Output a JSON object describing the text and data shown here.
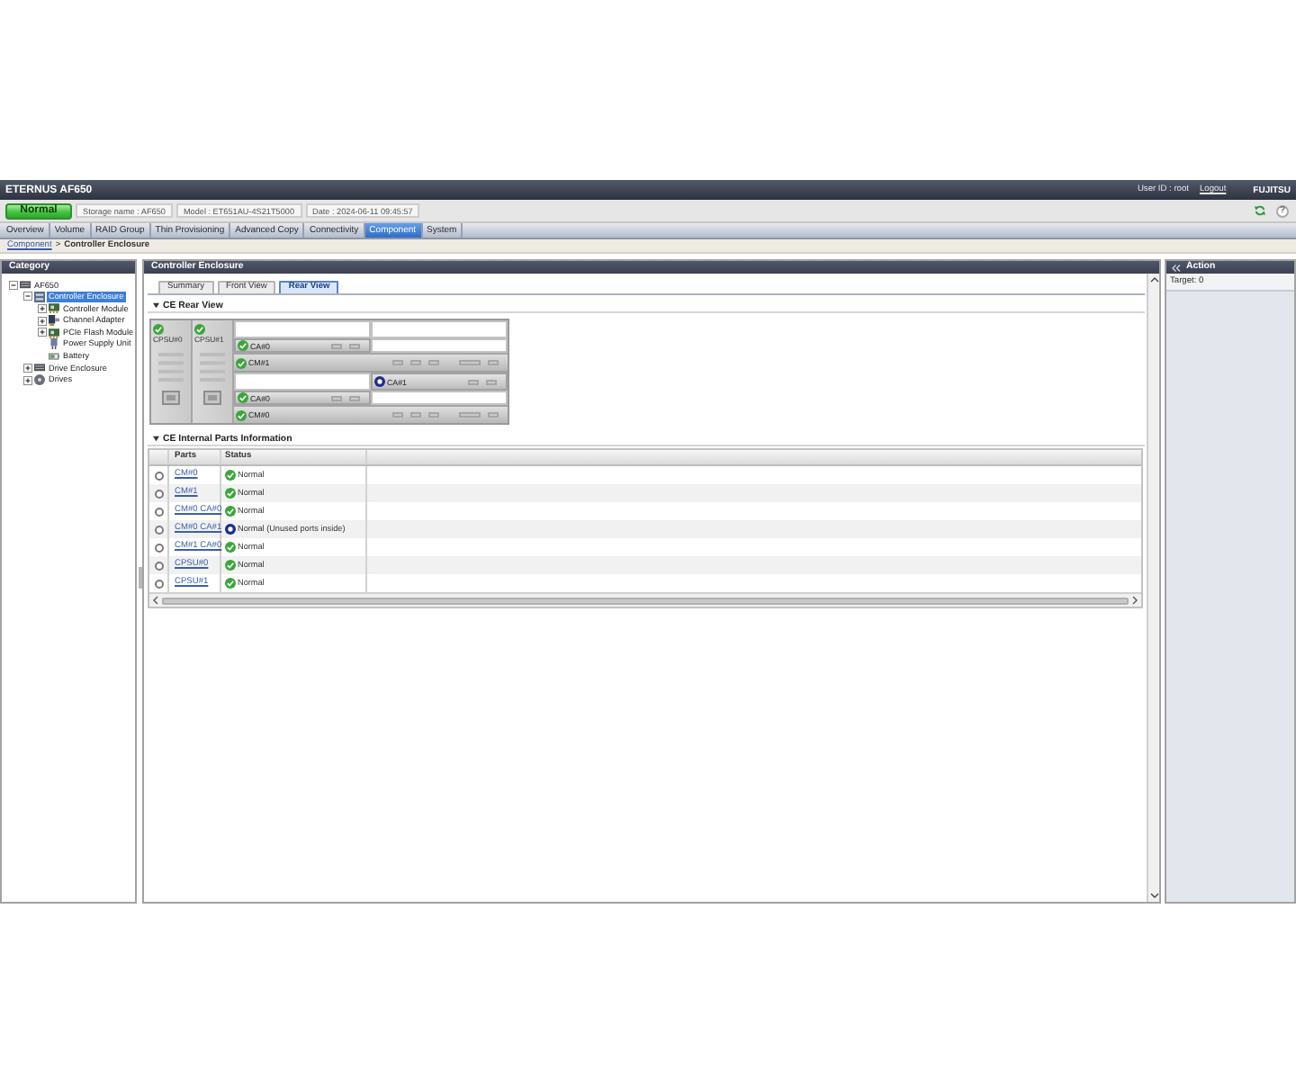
{
  "header": {
    "title": "ETERNUS AF650",
    "user_id": "User ID : root",
    "logout": "Logout",
    "logo": "FUJITSU"
  },
  "status_bar": {
    "status": "Normal",
    "fields": [
      "Storage name : AF650",
      "Model : ET651AU-4S21T5000",
      "Date : 2024-06-11 09:45:57"
    ],
    "help": "?"
  },
  "tabs": [
    {
      "label": "Overview",
      "selected": false
    },
    {
      "label": "Volume",
      "selected": false
    },
    {
      "label": "RAID Group",
      "selected": false
    },
    {
      "label": "Thin Provisioning",
      "selected": false
    },
    {
      "label": "Advanced Copy",
      "selected": false
    },
    {
      "label": "Connectivity",
      "selected": false
    },
    {
      "label": "Component",
      "selected": true
    },
    {
      "label": "System",
      "selected": false
    }
  ],
  "breadcrumb": {
    "link": "Component",
    "separator": ">",
    "current": "Controller Enclosure"
  },
  "category": {
    "title": "Category",
    "tree": [
      {
        "label": "AF650",
        "kind": "storage",
        "expanded": true,
        "selected": false,
        "children": [
          {
            "label": "Controller Enclosure",
            "kind": "enclosure",
            "expanded": true,
            "selected": true,
            "children": [
              {
                "label": "Controller Module",
                "kind": "module",
                "expanded": false,
                "selected": false
              },
              {
                "label": "Channel Adapter",
                "kind": "adapter",
                "expanded": false,
                "selected": false
              },
              {
                "label": "PCIe Flash Module",
                "kind": "module",
                "expanded": false,
                "selected": false
              },
              {
                "label": "Power Supply Unit",
                "kind": "power",
                "selected": false
              },
              {
                "label": "Battery",
                "kind": "battery",
                "selected": false
              }
            ]
          },
          {
            "label": "Drive Enclosure",
            "kind": "storage",
            "expanded": false,
            "selected": false
          },
          {
            "label": "Drives",
            "kind": "drives",
            "expanded": false,
            "selected": false
          }
        ]
      }
    ]
  },
  "main": {
    "title": "Controller Enclosure",
    "subtabs": [
      {
        "label": "Summary",
        "selected": false
      },
      {
        "label": "Front View",
        "selected": false
      },
      {
        "label": "Rear View",
        "selected": true
      }
    ],
    "rear_view": {
      "title": "CE Rear View",
      "expanded": true,
      "psus": [
        {
          "label": "CPSU#0",
          "unused_ports": false
        },
        {
          "label": "CPSU#1",
          "unused_ports": false
        }
      ],
      "modules": [
        {
          "slots": [
            {
              "kind": "empty"
            },
            {
              "kind": "empty"
            },
            {
              "kind": "ca",
              "label": "CA#0",
              "unused_ports": false
            },
            {
              "kind": "empty"
            }
          ],
          "cm": {
            "label": "CM#1",
            "unused_ports": false
          }
        },
        {
          "slots": [
            {
              "kind": "empty"
            },
            {
              "kind": "ca",
              "label": "CA#1",
              "unused_ports": true
            },
            {
              "kind": "ca",
              "label": "CA#0",
              "unused_ports": false
            },
            {
              "kind": "empty"
            }
          ],
          "cm": {
            "label": "CM#0",
            "unused_ports": false
          }
        }
      ]
    },
    "parts_table": {
      "title": "CE Internal Parts Information",
      "expanded": true,
      "columns": [
        "Parts",
        "Status"
      ],
      "rows": [
        {
          "part": "CM#0",
          "unused_ports": false,
          "status_text": "Normal",
          "selected": false
        },
        {
          "part": "CM#1",
          "unused_ports": false,
          "status_text": "Normal",
          "selected": false
        },
        {
          "part": "CM#0 CA#0",
          "unused_ports": false,
          "status_text": "Normal",
          "selected": false
        },
        {
          "part": "CM#0 CA#1",
          "unused_ports": true,
          "status_text": "Normal (Unused ports inside)",
          "selected": false
        },
        {
          "part": "CM#1 CA#0",
          "unused_ports": false,
          "status_text": "Normal",
          "selected": false
        },
        {
          "part": "CPSU#0",
          "unused_ports": false,
          "status_text": "Normal",
          "selected": false
        },
        {
          "part": "CPSU#1",
          "unused_ports": false,
          "status_text": "Normal",
          "selected": false
        }
      ]
    }
  },
  "action": {
    "title": "Action",
    "target": "Target: 0"
  }
}
